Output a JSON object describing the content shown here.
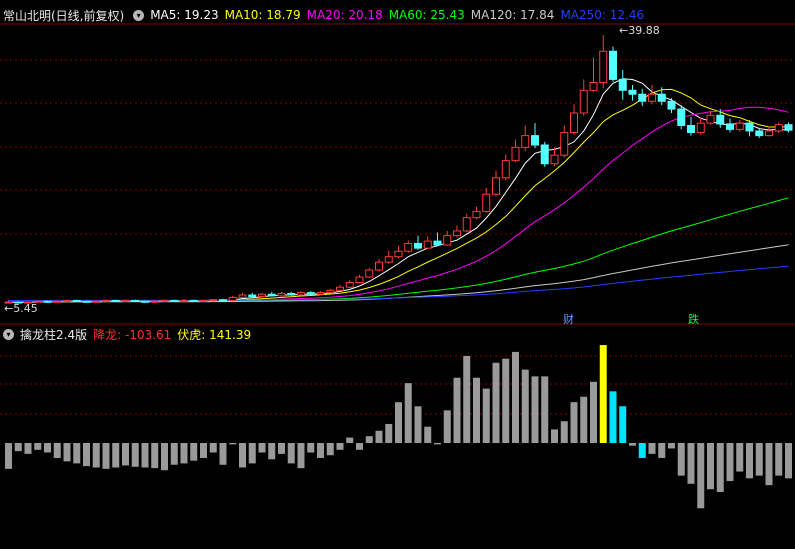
{
  "main_panel": {
    "title": "常山北明(日线,前复权)",
    "ma_legend": [
      {
        "label": "MA5: 19.23",
        "color": "#ffffff"
      },
      {
        "label": "MA10: 18.79",
        "color": "#ffff00"
      },
      {
        "label": "MA20: 20.18",
        "color": "#ff00ff"
      },
      {
        "label": "MA60: 25.43",
        "color": "#00ff00"
      },
      {
        "label": "MA120: 17.84",
        "color": "#c8c8c8"
      },
      {
        "label": "MA250: 12.46",
        "color": "#2040ff"
      }
    ],
    "high_label": "39.88",
    "low_label": "5.45",
    "marker_cai": "财",
    "marker_die": "跌"
  },
  "indicator_panel": {
    "title": "擒龙柱2.4版",
    "value1_label": "降龙: -103.61",
    "value2_label": "伏虎: 141.39"
  },
  "colors": {
    "up": "#ff3a3a",
    "down": "#54ffff",
    "grid": "#8a0000",
    "bar_gray": "#9a9a9a",
    "bar_yellow": "#ffff00",
    "bar_cyan": "#00e5ff"
  },
  "chart_data": {
    "type": "candlestick",
    "price_range": [
      5.45,
      39.88
    ],
    "candles": [
      [
        5.6,
        5.7,
        5.9,
        5.5
      ],
      [
        5.7,
        5.6,
        5.8,
        5.5
      ],
      [
        5.6,
        5.7,
        5.8,
        5.5
      ],
      [
        5.7,
        5.8,
        5.9,
        5.6
      ],
      [
        5.8,
        5.7,
        5.9,
        5.6
      ],
      [
        5.7,
        5.8,
        5.9,
        5.6
      ],
      [
        5.8,
        5.9,
        6.0,
        5.7
      ],
      [
        5.9,
        5.8,
        6.0,
        5.7
      ],
      [
        5.8,
        5.7,
        5.9,
        5.6
      ],
      [
        5.7,
        5.8,
        5.9,
        5.6
      ],
      [
        5.8,
        5.9,
        6.0,
        5.7
      ],
      [
        5.9,
        5.8,
        6.0,
        5.7
      ],
      [
        5.8,
        5.9,
        6.0,
        5.7
      ],
      [
        5.9,
        5.8,
        6.0,
        5.7
      ],
      [
        5.8,
        5.7,
        5.9,
        5.6
      ],
      [
        5.7,
        5.8,
        5.9,
        5.6
      ],
      [
        5.8,
        5.9,
        6.0,
        5.7
      ],
      [
        5.9,
        5.8,
        6.0,
        5.7
      ],
      [
        5.8,
        5.9,
        6.1,
        5.7
      ],
      [
        5.9,
        5.8,
        6.0,
        5.7
      ],
      [
        5.8,
        5.9,
        6.0,
        5.7
      ],
      [
        5.9,
        6.0,
        6.1,
        5.8
      ],
      [
        6.0,
        5.9,
        6.1,
        5.8
      ],
      [
        5.9,
        6.3,
        6.5,
        5.8
      ],
      [
        6.3,
        6.6,
        6.9,
        6.2
      ],
      [
        6.6,
        6.4,
        6.9,
        6.3
      ],
      [
        6.4,
        6.7,
        6.9,
        6.3
      ],
      [
        6.7,
        6.5,
        7.0,
        6.4
      ],
      [
        6.5,
        6.8,
        7.0,
        6.4
      ],
      [
        6.8,
        6.6,
        7.0,
        6.5
      ],
      [
        6.6,
        6.9,
        7.1,
        6.5
      ],
      [
        6.9,
        6.7,
        7.1,
        6.6
      ],
      [
        6.7,
        6.9,
        7.1,
        6.6
      ],
      [
        6.9,
        7.2,
        7.4,
        6.8
      ],
      [
        7.2,
        7.6,
        7.9,
        7.1
      ],
      [
        7.6,
        8.2,
        8.5,
        7.5
      ],
      [
        8.2,
        8.9,
        9.2,
        8.1
      ],
      [
        8.9,
        9.8,
        10.1,
        8.8
      ],
      [
        9.8,
        10.8,
        11.2,
        9.6
      ],
      [
        10.8,
        11.5,
        12.3,
        10.6
      ],
      [
        11.5,
        12.2,
        12.9,
        11.3
      ],
      [
        12.2,
        13.2,
        13.6,
        12.0
      ],
      [
        13.2,
        12.6,
        14.2,
        12.4
      ],
      [
        12.6,
        13.5,
        14.1,
        12.5
      ],
      [
        13.5,
        13.0,
        14.6,
        12.9
      ],
      [
        13.0,
        14.2,
        14.8,
        12.9
      ],
      [
        14.2,
        14.8,
        15.5,
        14.0
      ],
      [
        14.8,
        16.5,
        17.0,
        14.6
      ],
      [
        16.5,
        17.3,
        17.9,
        16.3
      ],
      [
        17.3,
        19.5,
        20.3,
        17.1
      ],
      [
        19.5,
        21.6,
        22.5,
        19.2
      ],
      [
        21.6,
        23.8,
        24.6,
        21.3
      ],
      [
        23.8,
        25.5,
        26.5,
        23.6
      ],
      [
        25.5,
        27.0,
        28.3,
        25.0
      ],
      [
        27.0,
        25.8,
        28.6,
        25.4
      ],
      [
        25.8,
        23.4,
        26.2,
        23.0
      ],
      [
        23.4,
        24.5,
        25.5,
        23.1
      ],
      [
        24.5,
        27.4,
        28.3,
        24.2
      ],
      [
        27.4,
        29.9,
        31.0,
        27.1
      ],
      [
        29.9,
        32.8,
        34.2,
        29.5
      ],
      [
        32.8,
        33.8,
        37.0,
        32.6
      ],
      [
        33.8,
        37.8,
        39.88,
        33.1
      ],
      [
        37.8,
        34.2,
        38.4,
        33.9
      ],
      [
        34.2,
        32.8,
        35.4,
        31.6
      ],
      [
        32.8,
        32.3,
        33.5,
        31.5
      ],
      [
        32.3,
        31.4,
        33.0,
        30.8
      ],
      [
        31.4,
        32.3,
        33.5,
        31.0
      ],
      [
        32.3,
        31.4,
        33.2,
        30.9
      ],
      [
        31.4,
        30.4,
        31.8,
        29.9
      ],
      [
        30.4,
        28.3,
        30.9,
        27.8
      ],
      [
        28.3,
        27.4,
        29.4,
        27.0
      ],
      [
        27.4,
        28.6,
        29.3,
        27.1
      ],
      [
        28.6,
        29.6,
        30.2,
        28.4
      ],
      [
        29.6,
        28.5,
        30.4,
        28.0
      ],
      [
        28.5,
        27.8,
        29.2,
        27.4
      ],
      [
        27.8,
        28.6,
        29.0,
        27.5
      ],
      [
        28.6,
        27.6,
        29.0,
        26.9
      ],
      [
        27.6,
        27.0,
        28.0,
        26.7
      ],
      [
        27.0,
        27.6,
        28.2,
        26.9
      ],
      [
        27.6,
        28.4,
        28.7,
        27.3
      ],
      [
        28.4,
        27.7,
        28.7,
        27.4
      ]
    ],
    "indicator_bars": [
      -38,
      -12,
      -16,
      -10,
      -14,
      -22,
      -27,
      -30,
      -34,
      -36,
      -38,
      -36,
      -33,
      -35,
      -36,
      -37,
      -40,
      -32,
      -30,
      -26,
      -22,
      -14,
      -32,
      -2,
      -36,
      -30,
      -14,
      -24,
      -16,
      -30,
      -37,
      -14,
      -22,
      -18,
      -10,
      8,
      -10,
      10,
      18,
      28,
      60,
      88,
      54,
      24,
      -2,
      48,
      96,
      128,
      96,
      80,
      118,
      124,
      134,
      108,
      98,
      98,
      20,
      32,
      60,
      68,
      90,
      144,
      76,
      54,
      -4,
      -22,
      -16,
      -22,
      -8,
      -48,
      -60,
      -96,
      -68,
      -72,
      -56,
      -42,
      -52,
      -48,
      -62,
      -48,
      -52
    ],
    "indicator_range": [
      -103.61,
      141.39
    ]
  }
}
